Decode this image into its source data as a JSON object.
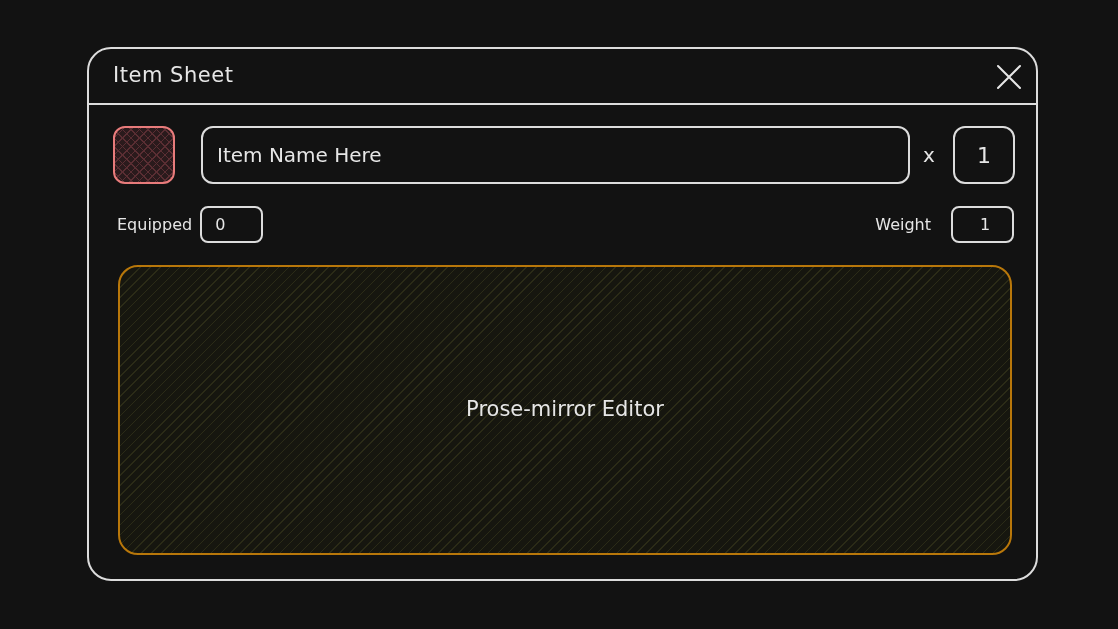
{
  "window": {
    "title": "Item Sheet"
  },
  "item": {
    "name": "Item Name Here",
    "quantity_prefix": "x",
    "quantity": "1"
  },
  "fields": [
    {
      "label": "Equipped",
      "value": "0"
    },
    {
      "label": "Weight",
      "value": "1"
    }
  ],
  "editor": {
    "label": "Prose-mirror Editor"
  }
}
